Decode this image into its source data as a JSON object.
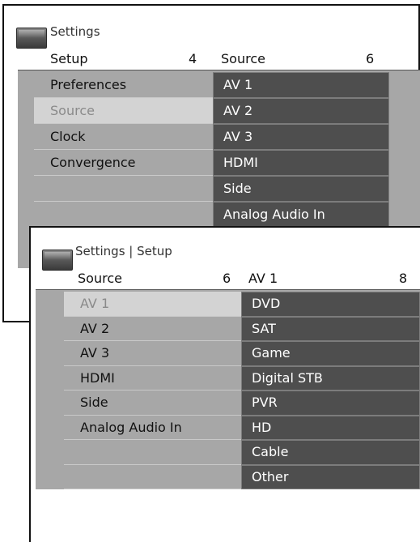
{
  "panel1": {
    "title": "Settings",
    "left_header": {
      "label": "Setup",
      "count": "4"
    },
    "right_header": {
      "label": "Source",
      "count": "6"
    },
    "menu": [
      "Preferences",
      "Source",
      "Clock",
      "Convergence"
    ],
    "selected_index": 1,
    "submenu": [
      "AV 1",
      "AV 2",
      "AV 3",
      "HDMI",
      "Side",
      "Analog Audio In"
    ]
  },
  "panel2": {
    "title": "Settings | Setup",
    "left_header": {
      "label": "Source",
      "count": "6"
    },
    "right_header": {
      "label": "AV 1",
      "count": "8"
    },
    "menu": [
      "AV 1",
      "AV 2",
      "AV 3",
      "HDMI",
      "Side",
      "Analog Audio In"
    ],
    "selected_index": 0,
    "submenu": [
      "DVD",
      "SAT",
      "Game",
      "Digital STB",
      "PVR",
      "HD",
      "Cable",
      "Other"
    ]
  }
}
